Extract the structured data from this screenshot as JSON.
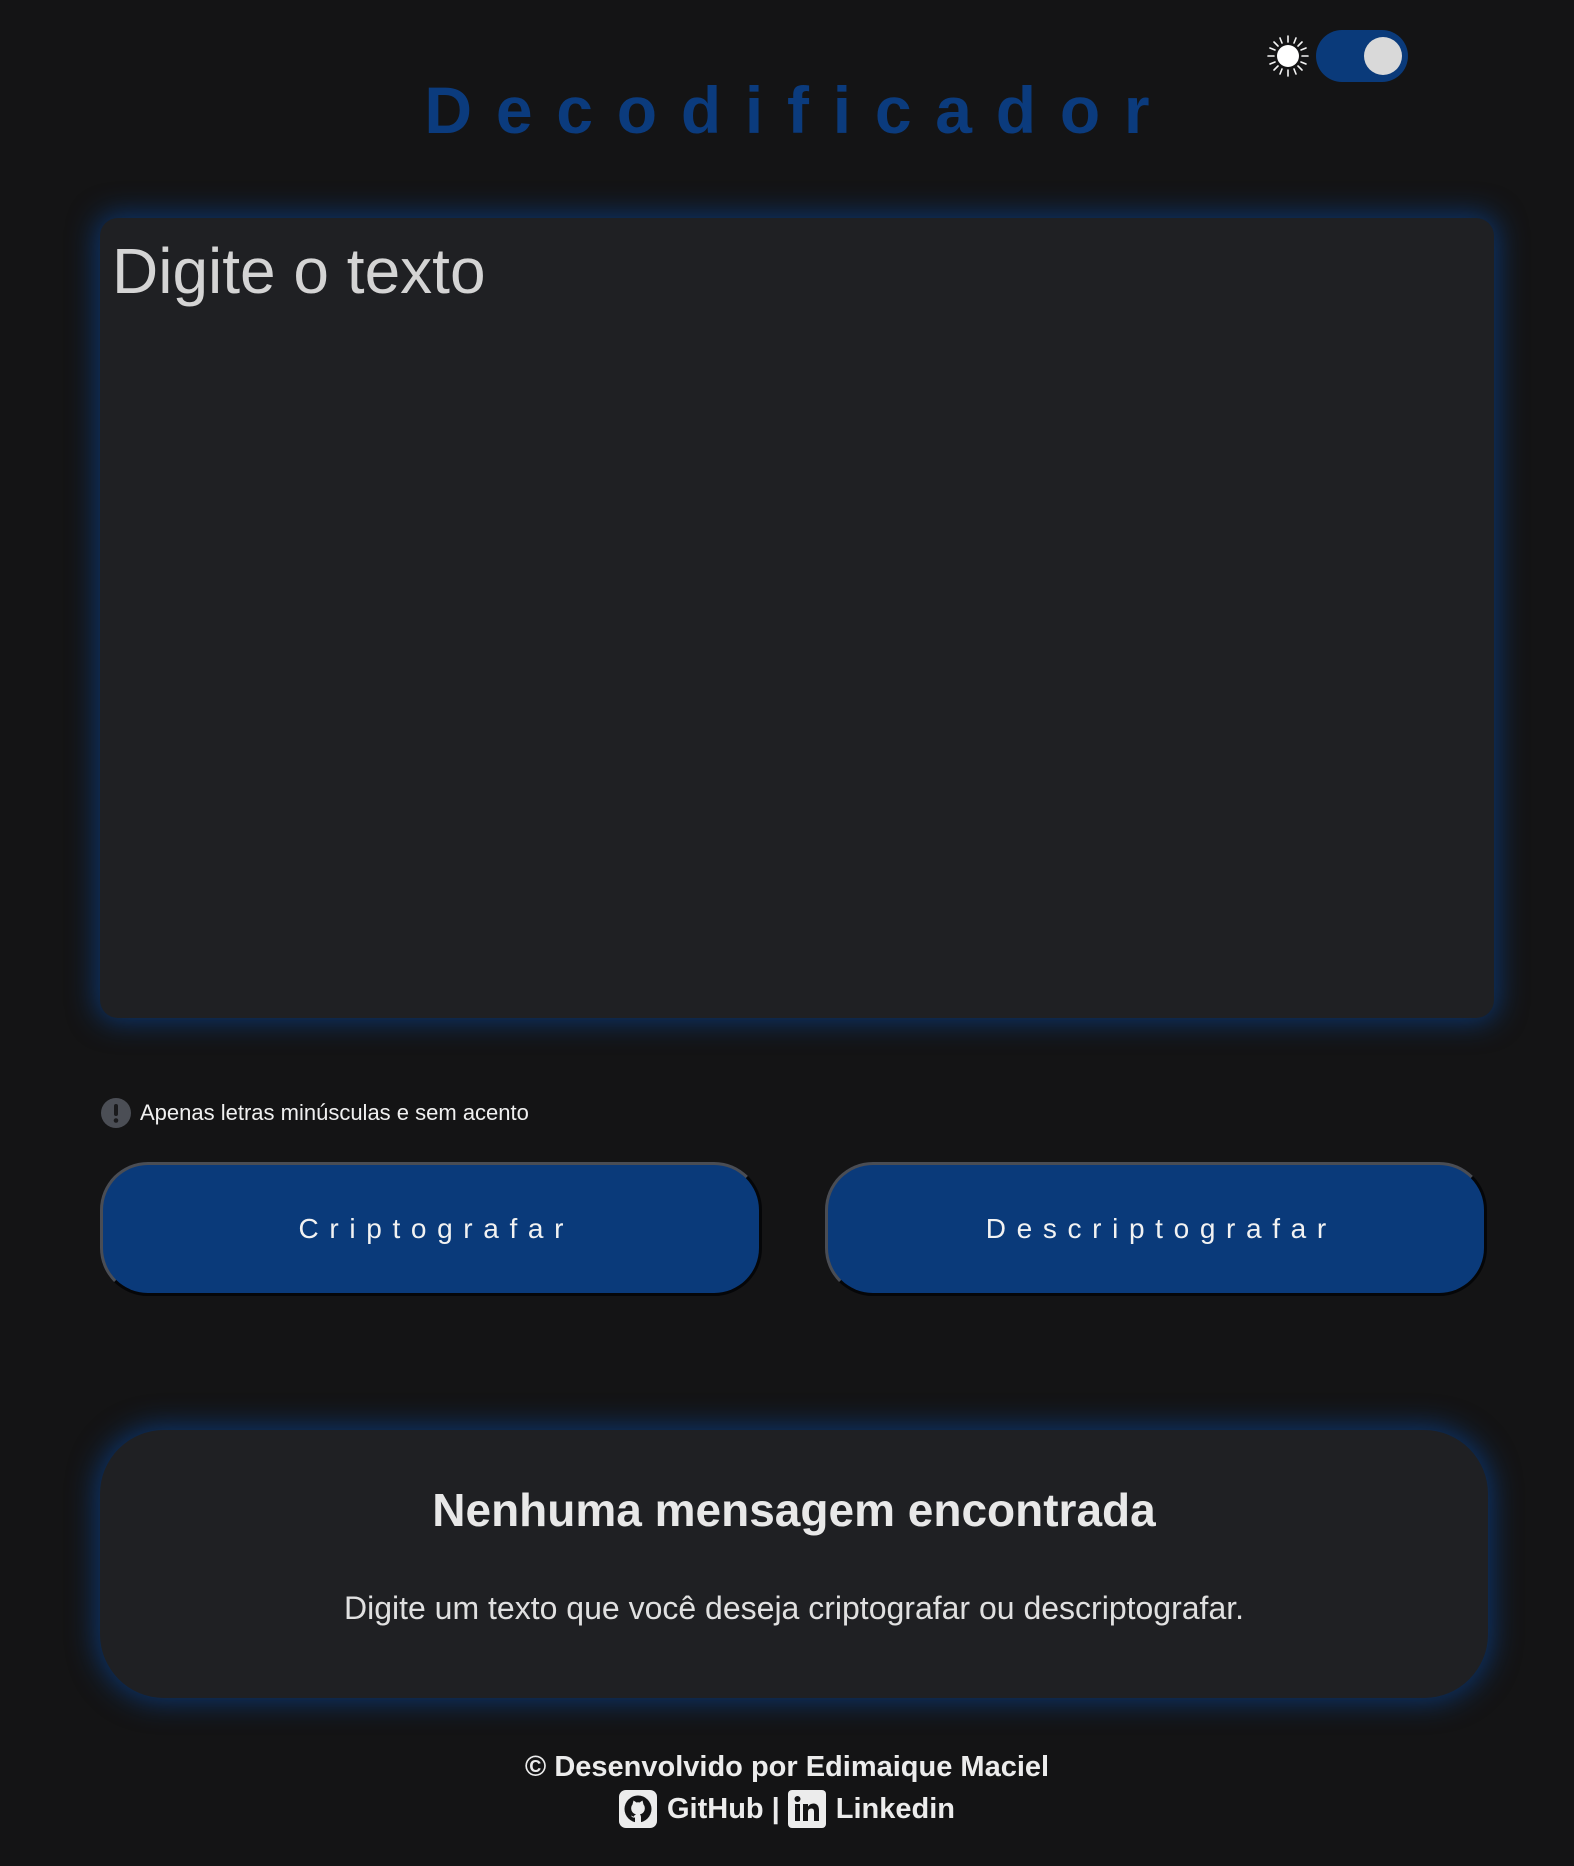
{
  "theme_toggle": {
    "state": "on",
    "icon": "sun-icon"
  },
  "header": {
    "title": "Decodificador"
  },
  "input": {
    "placeholder": "Digite o texto",
    "value": ""
  },
  "hint": {
    "icon": "alert-circle-icon",
    "text": "Apenas letras minúsculas e sem acento"
  },
  "actions": {
    "encrypt_label": "Criptografar",
    "decrypt_label": "Descriptografar"
  },
  "result": {
    "title": "Nenhuma mensagem encontrada",
    "text": "Digite um texto que você deseja criptografar ou descriptografar."
  },
  "footer": {
    "credit": "© Desenvolvido por Edimaique Maciel",
    "github_label": "GitHub",
    "separator": "|",
    "linkedin_label": "Linkedin"
  },
  "colors": {
    "background": "#141415",
    "accent": "#0a3a7a",
    "panel": "#1f2023",
    "glow": "#0b3b7d"
  }
}
